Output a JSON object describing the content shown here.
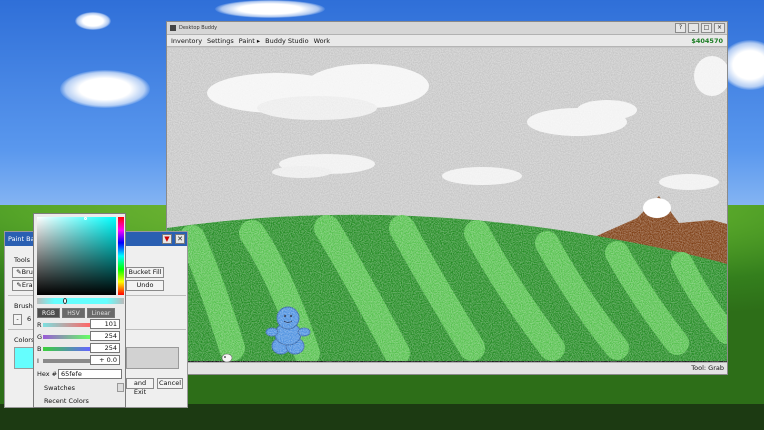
{
  "window": {
    "title": "Desktop Buddy",
    "buttons": {
      "help": "?",
      "minimize": "_",
      "maximize": "□",
      "close": "×"
    },
    "menu": [
      "Inventory",
      "Settings",
      "Paint ▸",
      "Buddy Studio",
      "Work"
    ],
    "money": "$404570",
    "status_tool": "Tool: Grab"
  },
  "paint_bar": {
    "title": "Paint Ba",
    "sections": {
      "tools": "Tools",
      "brush": "Brush",
      "colors": "Colors"
    },
    "tools": {
      "brush": "Bru",
      "eraser": "Era",
      "bucket_fill": "Bucket Fill",
      "undo": "Undo"
    },
    "brush_minus": "-",
    "brush_value": "6",
    "footer": {
      "save_exit": "and Exit",
      "cancel": "Cancel"
    },
    "current_color": "#65fefe"
  },
  "color_picker": {
    "tabs": [
      "RGB",
      "HSV",
      "Linear"
    ],
    "active_tab": "RGB",
    "channels": [
      {
        "label": "R",
        "value": "101",
        "color": "#ff6565"
      },
      {
        "label": "G",
        "value": "254",
        "color": "#65fe65"
      },
      {
        "label": "B",
        "value": "254",
        "color": "#6565fe"
      },
      {
        "label": "I",
        "value": "+ 0.0",
        "color": "#8a8a8a"
      }
    ],
    "hex_label": "Hex #",
    "hex_value": "65fefe",
    "swatches_label": "Swatches",
    "recent_label": "Recent Colors"
  }
}
